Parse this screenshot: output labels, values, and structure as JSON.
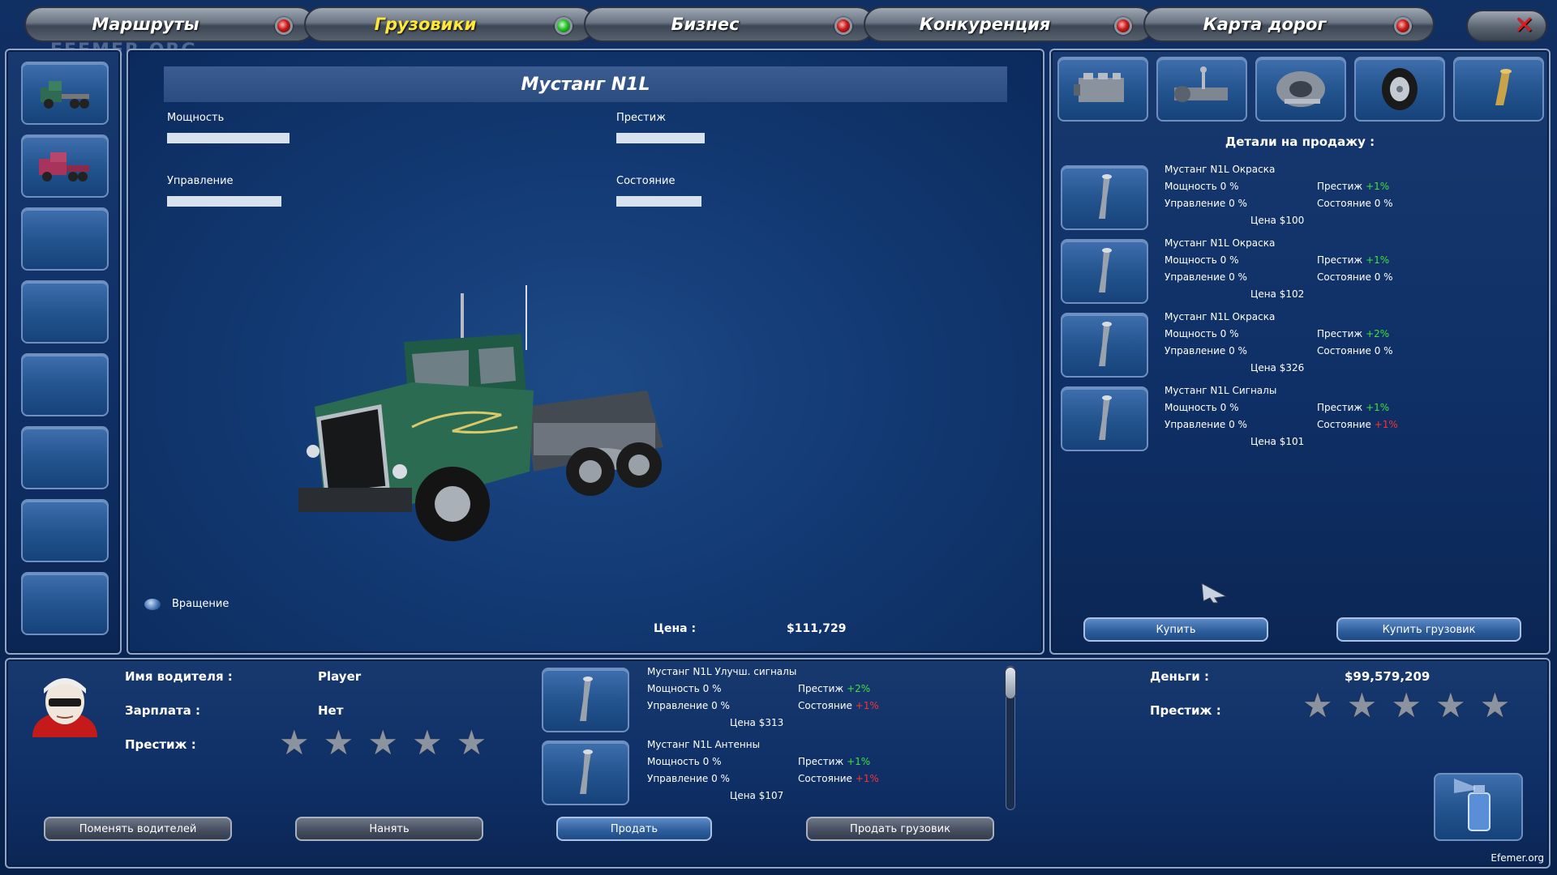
{
  "nav": {
    "tabs": [
      {
        "label": "Маршруты",
        "active": false
      },
      {
        "label": "Грузовики",
        "active": true
      },
      {
        "label": "Бизнес",
        "active": false
      },
      {
        "label": "Конкуренция",
        "active": false
      },
      {
        "label": "Карта дорог",
        "active": false
      }
    ],
    "close_icon": "close-icon"
  },
  "watermark": "EFEMER.ORG",
  "truck": {
    "name": "Мустанг N1L",
    "stats": {
      "power_label": "Мощность",
      "power_level": 0.42,
      "prestige_label": "Престиж",
      "prestige_level": 0.32,
      "handling_label": "Управление",
      "handling_level": 0.38,
      "condition_label": "Состояние",
      "condition_level": 0.31
    },
    "rotate_label": "Вращение",
    "price_label": "Цена :",
    "price_value": "$111,729"
  },
  "shop": {
    "category_icons": [
      "engine-icon",
      "transmission-icon",
      "suspension-icon",
      "tire-icon",
      "exhaust-icon"
    ],
    "header": "Детали на продажу :",
    "items": [
      {
        "name": "Мустанг N1L Окраска",
        "power": "Мощность 0 %",
        "prestige_label": "Престиж",
        "prestige_value": "+1%",
        "prestige_sign": "pos",
        "handling": "Управление 0 %",
        "condition_label": "Состояние",
        "condition_value": "0 %",
        "condition_sign": "none",
        "price": "Цена $100"
      },
      {
        "name": "Мустанг N1L Окраска",
        "power": "Мощность 0 %",
        "prestige_label": "Престиж",
        "prestige_value": "+1%",
        "prestige_sign": "pos",
        "handling": "Управление 0 %",
        "condition_label": "Состояние",
        "condition_value": "0 %",
        "condition_sign": "none",
        "price": "Цена $102"
      },
      {
        "name": "Мустанг N1L Окраска",
        "power": "Мощность 0 %",
        "prestige_label": "Престиж",
        "prestige_value": "+2%",
        "prestige_sign": "pos",
        "handling": "Управление 0 %",
        "condition_label": "Состояние",
        "condition_value": "0 %",
        "condition_sign": "none",
        "price": "Цена $326"
      },
      {
        "name": "Мустанг N1L Сигналы",
        "power": "Мощность 0 %",
        "prestige_label": "Престиж",
        "prestige_value": "+1%",
        "prestige_sign": "pos",
        "handling": "Управление 0 %",
        "condition_label": "Состояние",
        "condition_value": "+1%",
        "condition_sign": "neg",
        "price": "Цена $101"
      }
    ],
    "buy_label": "Купить",
    "buy_truck_label": "Купить грузовик"
  },
  "driver": {
    "name_label": "Имя водителя :",
    "name_value": "Player",
    "salary_label": "Зарплата :",
    "salary_value": "Нет",
    "prestige_label": "Престиж :",
    "prestige_stars": 0,
    "change_label": "Поменять водителей",
    "hire_label": "Нанять"
  },
  "owned": {
    "items": [
      {
        "name": "Мустанг N1L Улучш. сигналы",
        "power": "Мощность 0 %",
        "prestige_label": "Престиж",
        "prestige_value": "+2%",
        "handling": "Управление 0 %",
        "condition_label": "Состояние",
        "condition_value": "+1%",
        "price": "Цена $313"
      },
      {
        "name": "Мустанг N1L Антенны",
        "power": "Мощность 0 %",
        "prestige_label": "Престиж",
        "prestige_value": "+1%",
        "handling": "Управление 0 %",
        "condition_label": "Состояние",
        "condition_value": "+1%",
        "price": "Цена $107"
      }
    ],
    "sell_label": "Продать",
    "sell_truck_label": "Продать грузовик"
  },
  "company": {
    "money_label": "Деньги :",
    "money_value": "$99,579,209",
    "prestige_label": "Престиж :",
    "prestige_stars": 0,
    "color_button_icon": "spray-paint-icon"
  },
  "credit": "Efemer.org",
  "colors": {
    "positive": "#3de23d",
    "negative": "#ff3030",
    "active_tab": "#ffe63a"
  }
}
